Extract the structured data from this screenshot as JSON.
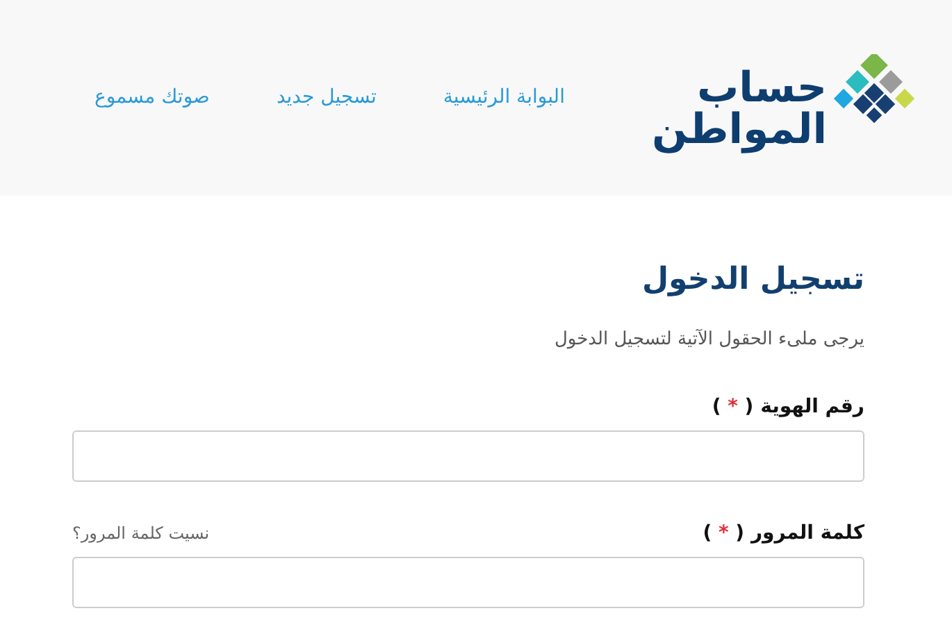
{
  "header": {
    "logo_lines": [
      "حساب",
      "المواطن"
    ],
    "nav": [
      {
        "label": "البوابة الرئيسية"
      },
      {
        "label": "تسجيل جديد"
      },
      {
        "label": "صوتك مسموع"
      }
    ]
  },
  "login": {
    "title": "تسجيل الدخول",
    "subtitle": "يرجى ملىء الحقول الآتية لتسجيل الدخول",
    "fields": [
      {
        "label": "رقم الهوية",
        "required": true,
        "required_mark": [
          "(",
          "*",
          ")"
        ]
      },
      {
        "label": "كلمة المرور",
        "required": true,
        "required_mark": [
          "(",
          "*",
          ")"
        ],
        "link": "نسيت كلمة المرور؟"
      }
    ]
  }
}
